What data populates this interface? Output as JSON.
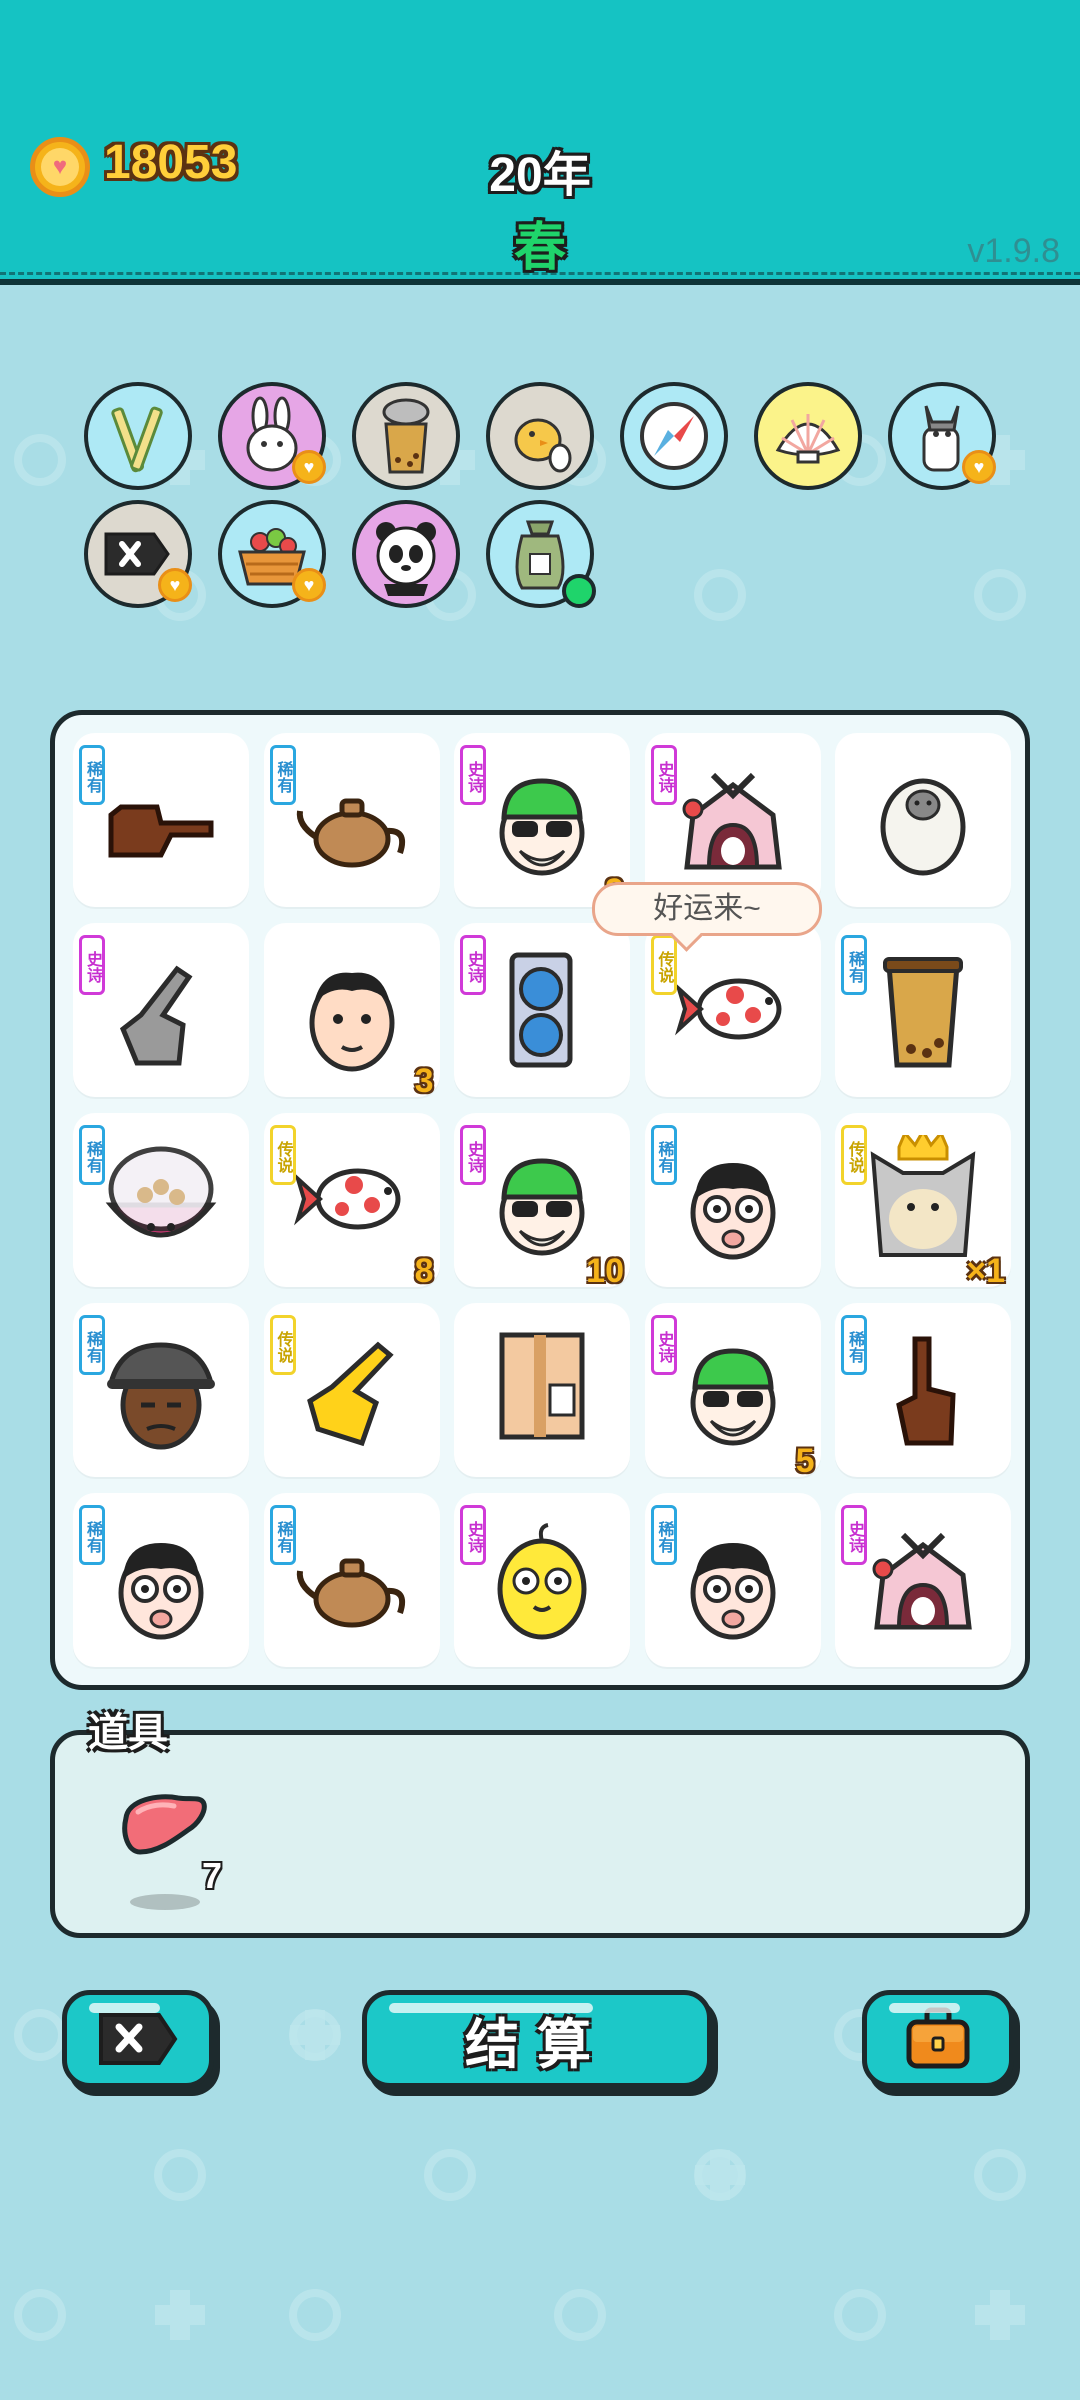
{
  "header": {
    "coins": "18053",
    "year": "20年",
    "season": "春",
    "version": "v1.9.8"
  },
  "collection": [
    {
      "icon": "fries-icon",
      "bg": "#aee9f5",
      "badge": false
    },
    {
      "icon": "bunny-icon",
      "bg": "#e6a6e6",
      "badge": true
    },
    {
      "icon": "bubble-tea-icon",
      "bg": "#ddd9cf",
      "badge": false
    },
    {
      "icon": "chick-egg-icon",
      "bg": "#ddd9cf",
      "badge": false
    },
    {
      "icon": "compass-icon",
      "bg": "#aee9f5",
      "badge": false
    },
    {
      "icon": "shell-icon",
      "bg": "#fbf38a",
      "badge": false
    },
    {
      "icon": "husky-icon",
      "bg": "#aee9f5",
      "badge": true
    },
    {
      "icon": "remove-tag-icon",
      "bg": "#ddd9cf",
      "badge": true
    },
    {
      "icon": "fruit-basket-icon",
      "bg": "#aee9f5",
      "badge": true
    },
    {
      "icon": "panda-icon",
      "bg": "#e6a6e6",
      "badge": false
    },
    {
      "icon": "seed-bag-icon",
      "bg": "#aee9f5",
      "badge": false,
      "dot": true
    }
  ],
  "rarity": {
    "rare": "稀有",
    "epic": "史诗",
    "legend": "传说"
  },
  "board": [
    {
      "icon": "pointing-hand-icon",
      "tag": "rare",
      "count": ""
    },
    {
      "icon": "teapot-icon",
      "tag": "rare",
      "count": ""
    },
    {
      "icon": "green-hat-man-icon",
      "tag": "epic",
      "count": "9"
    },
    {
      "icon": "rabbit-house-icon",
      "tag": "epic",
      "count": ""
    },
    {
      "icon": "sheep-icon",
      "tag": "",
      "count": ""
    },
    {
      "icon": "gray-hand-icon",
      "tag": "epic",
      "count": ""
    },
    {
      "icon": "man-face-icon",
      "tag": "",
      "count": "3"
    },
    {
      "icon": "graphics-card-icon",
      "tag": "epic",
      "count": ""
    },
    {
      "icon": "koi-fish-icon",
      "tag": "legend",
      "count": ""
    },
    {
      "icon": "bubble-tea-cup-icon",
      "tag": "rare",
      "count": ""
    },
    {
      "icon": "bowl-icon",
      "tag": "rare",
      "count": ""
    },
    {
      "icon": "koi-fish-icon",
      "tag": "legend",
      "count": "8"
    },
    {
      "icon": "green-hat-man-icon",
      "tag": "epic",
      "count": "10"
    },
    {
      "icon": "boy-glasses-icon",
      "tag": "rare",
      "count": ""
    },
    {
      "icon": "crowned-husky-icon",
      "tag": "legend",
      "count": "×1"
    },
    {
      "icon": "bucket-hat-man-icon",
      "tag": "rare",
      "count": ""
    },
    {
      "icon": "yellow-hand-icon",
      "tag": "legend",
      "count": ""
    },
    {
      "icon": "parcel-box-icon",
      "tag": "",
      "count": ""
    },
    {
      "icon": "green-hat-man-icon",
      "tag": "epic",
      "count": "5"
    },
    {
      "icon": "finger-up-icon",
      "tag": "rare",
      "count": ""
    },
    {
      "icon": "boy-glasses-icon",
      "tag": "rare",
      "count": ""
    },
    {
      "icon": "teapot-icon",
      "tag": "rare",
      "count": ""
    },
    {
      "icon": "yellow-chick-icon",
      "tag": "epic",
      "count": ""
    },
    {
      "icon": "boy-glasses-icon",
      "tag": "rare",
      "count": ""
    },
    {
      "icon": "rabbit-house-icon",
      "tag": "epic",
      "count": ""
    }
  ],
  "bubble": "好运来~",
  "tools": {
    "title": "道具",
    "items": [
      {
        "icon": "liver-icon",
        "count": "7"
      }
    ]
  },
  "buttons": {
    "remove_icon": "remove-tag-icon",
    "settle_label": "结算",
    "bag_icon": "briefcase-icon"
  }
}
